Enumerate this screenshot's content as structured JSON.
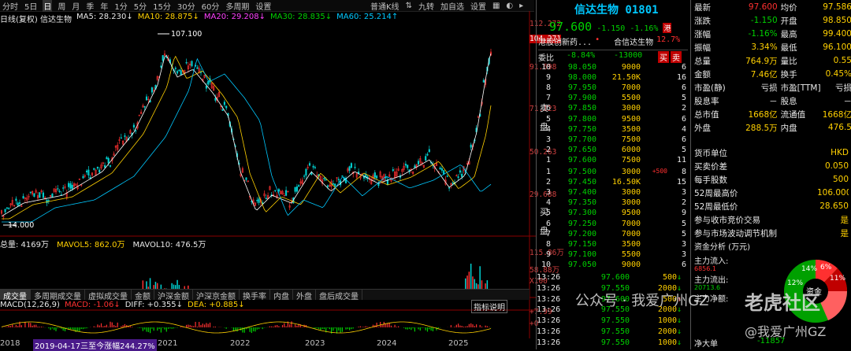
{
  "toolbar": {
    "left_items": [
      "分时",
      "5日",
      "日",
      "周",
      "月",
      "季",
      "年",
      "1分",
      "5分",
      "15分",
      "30分",
      "60分",
      "多周期",
      "设置"
    ],
    "selected": "日",
    "right_items": [
      "普通K线",
      "九转",
      "加自选",
      "设置"
    ],
    "icons": [
      "scale-icon",
      "grid-icon",
      "help-icon",
      "arrow-icon"
    ]
  },
  "ma_bar": {
    "label": "日线(复权) 信达生物",
    "ma5": "MA5: 28.230↓",
    "ma10": "MA10: 28.875↓",
    "ma20": "MA20: 29.208↓",
    "ma30": "MA30: 28.835↓",
    "ma60": "MA60: 25.214↑"
  },
  "price_axis": [
    "112.272",
    "104.271",
    "91.698",
    "71.123",
    "50.263",
    "29.688"
  ],
  "annotations": {
    "high": "107.100",
    "low": "14.000"
  },
  "volume_bar": {
    "label": "总量: 4169万",
    "mavol5": "MAVOL5: 862.0万",
    "mavol10": "MAVOL10: 476.5万"
  },
  "volume_axis": [
    "115.86万",
    "58.88万",
    "X100"
  ],
  "tabs": [
    "成交量",
    "多周期成交量",
    "虚拟成交量",
    "金额",
    "沪深金额",
    "沪深京金额",
    "换手率",
    "内盘",
    "外盘",
    "盘后成交量"
  ],
  "macd_bar": {
    "label": "MACD(12,26,9)",
    "macd": "MACD: -1.06↓",
    "diff": "DIFF: +0.355↓",
    "dea": "DEA: +0.885↓",
    "explain": "指标说明"
  },
  "macd_axis": [
    "+7.99",
    "+0"
  ],
  "years": {
    "range": "2019-04-17三至今涨幅244.27%",
    "labels": [
      "2018",
      "2021",
      "2022",
      "2023",
      "2024",
      "2025"
    ]
  },
  "quote": {
    "name": "信达生物 01801",
    "price": "97.600",
    "change": "-1.150",
    "pct": "-1.16%",
    "tag": "港",
    "sector": "港股创新药...",
    "sector_star": "•",
    "holding": "合信达生物",
    "holding_pct": "12.7%",
    "weibi_label": "委比",
    "weibi": "-8.84%",
    "weicha": "-13000",
    "buy_btn": "买",
    "sell_btn": "卖",
    "sell_label": "卖盘",
    "buy_label": "买盘"
  },
  "asks": [
    {
      "lvl": "10",
      "p": "98.050",
      "v": "9000",
      "n": "6"
    },
    {
      "lvl": "9",
      "p": "98.000",
      "v": "21.50K",
      "n": "16"
    },
    {
      "lvl": "8",
      "p": "97.950",
      "v": "7000",
      "n": "6"
    },
    {
      "lvl": "7",
      "p": "97.900",
      "v": "5500",
      "n": "5"
    },
    {
      "lvl": "6",
      "p": "97.850",
      "v": "3000",
      "n": "2"
    },
    {
      "lvl": "5",
      "p": "97.800",
      "v": "9500",
      "n": "6"
    },
    {
      "lvl": "4",
      "p": "97.750",
      "v": "3500",
      "n": "4"
    },
    {
      "lvl": "3",
      "p": "97.700",
      "v": "7500",
      "n": "6"
    },
    {
      "lvl": "2",
      "p": "97.650",
      "v": "6000",
      "n": "5"
    },
    {
      "lvl": "1",
      "p": "97.600",
      "v": "7500",
      "n": "11"
    }
  ],
  "bids": [
    {
      "lvl": "1",
      "p": "97.500",
      "v": "3000",
      "n": "8",
      "extra": "+500"
    },
    {
      "lvl": "2",
      "p": "97.450",
      "v": "16.50K",
      "n": "15",
      "extra": ""
    },
    {
      "lvl": "3",
      "p": "97.400",
      "v": "3000",
      "n": "3",
      "extra": ""
    },
    {
      "lvl": "4",
      "p": "97.350",
      "v": "3000",
      "n": "2",
      "extra": ""
    },
    {
      "lvl": "5",
      "p": "97.300",
      "v": "9500",
      "n": "9",
      "extra": ""
    },
    {
      "lvl": "6",
      "p": "97.250",
      "v": "7000",
      "n": "5",
      "extra": ""
    },
    {
      "lvl": "7",
      "p": "97.200",
      "v": "7000",
      "n": "5",
      "extra": ""
    },
    {
      "lvl": "8",
      "p": "97.150",
      "v": "3500",
      "n": "3",
      "extra": ""
    },
    {
      "lvl": "9",
      "p": "97.100",
      "v": "5500",
      "n": "3",
      "extra": ""
    },
    {
      "lvl": "10",
      "p": "97.050",
      "v": "9000",
      "n": "6",
      "extra": ""
    }
  ],
  "ticks": [
    {
      "t": "13:26",
      "p": "97.600",
      "v": "500",
      "d": "↓"
    },
    {
      "t": "13:26",
      "p": "97.550",
      "v": "2000",
      "d": "↓"
    },
    {
      "t": "13:26",
      "p": "97.600",
      "v": "500",
      "d": "↑"
    },
    {
      "t": "13:26",
      "p": "97.550",
      "v": "2000",
      "d": "↓"
    },
    {
      "t": "13:26",
      "p": "97.550",
      "v": "1000",
      "d": "↓"
    },
    {
      "t": "13:26",
      "p": "97.550",
      "v": "2000",
      "d": "↓"
    },
    {
      "t": "13:26",
      "p": "97.550",
      "v": "1000",
      "d": "↓"
    }
  ],
  "stats": [
    {
      "a": "最新",
      "b": "97.600",
      "c": "均价",
      "d": "97.586"
    },
    {
      "a": "涨跌",
      "b": "-1.150",
      "c": "开盘",
      "d": "98.850"
    },
    {
      "a": "涨幅",
      "b": "-1.16%",
      "c": "最高",
      "d": "99.400"
    },
    {
      "a": "振幅",
      "b": "3.34%",
      "c": "最低",
      "d": "96.100"
    },
    {
      "a": "总量",
      "b": "764.9万",
      "c": "量比",
      "d": "0.55"
    },
    {
      "a": "金额",
      "b": "7.46亿",
      "c": "换手",
      "d": "0.45%"
    },
    {
      "a": "市盈(静)",
      "b": "亏损",
      "c": "市盈[TTM]",
      "d": "亏损"
    },
    {
      "a": "股息率",
      "b": "－",
      "c": "股息",
      "d": "－"
    },
    {
      "a": "总市值",
      "b": "1668亿",
      "c": "流通值",
      "d": "1668亿"
    },
    {
      "a": "外盘",
      "b": "288.5万",
      "c": "内盘",
      "d": "476.5"
    }
  ],
  "info": [
    {
      "k": "货币单位",
      "v": "HKD"
    },
    {
      "k": "买卖价差",
      "v": "0.050"
    },
    {
      "k": "每手股数",
      "v": "500"
    },
    {
      "k": "52周最高价",
      "v": "106.000"
    },
    {
      "k": "52周最低价",
      "v": "28.650"
    },
    {
      "k": "参与收市竞价交易",
      "v": "是"
    },
    {
      "k": "参与市场波动调节机制",
      "v": "是"
    }
  ],
  "capital": {
    "title": "资金分析 (万元)",
    "inflow_label": "主力流入:",
    "inflow": "6856.1",
    "outflow_label": "主力流出:",
    "outflow": "20713.6",
    "net_label": "主力净额:",
    "pcts": [
      "14%",
      "6%",
      "11%",
      "12%"
    ],
    "center": "资金",
    "net_big_label": "净大单",
    "net_big": "-11857"
  },
  "watermark": {
    "line1": "公众号 · 我爱广州GZ",
    "brand": "老虎社区",
    "line2": "@我爱广州GZ"
  }
}
